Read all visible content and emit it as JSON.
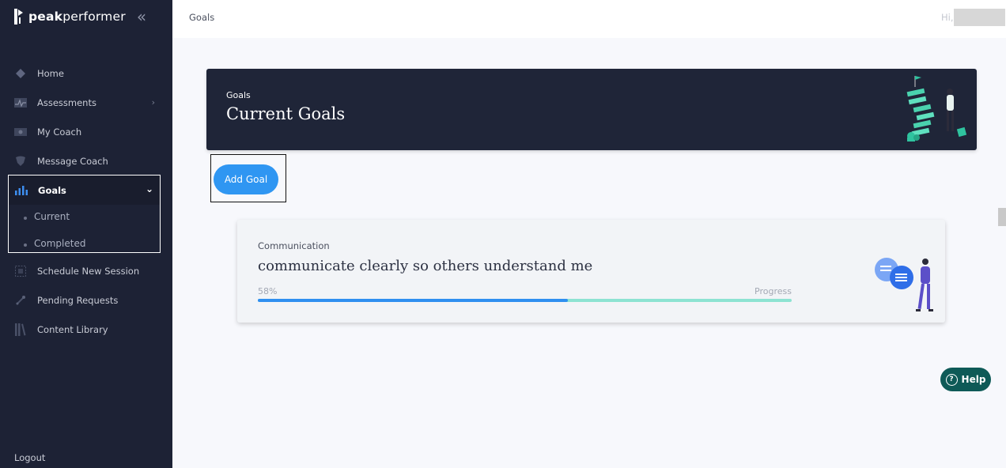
{
  "sidebar": {
    "brand_bold": "peak",
    "brand_rest": "performer",
    "items": [
      {
        "label": "Home",
        "icon": "home-icon"
      },
      {
        "label": "Assessments",
        "icon": "assessments-icon"
      },
      {
        "label": "My Coach",
        "icon": "coach-icon"
      },
      {
        "label": "Message Coach",
        "icon": "message-icon"
      },
      {
        "label": "Goals",
        "icon": "goals-icon"
      },
      {
        "label": "Schedule New Session",
        "icon": "calendar-icon"
      },
      {
        "label": "Pending Requests",
        "icon": "pending-icon"
      },
      {
        "label": "Content Library",
        "icon": "library-icon"
      }
    ],
    "goals_sub": [
      "Current",
      "Completed"
    ],
    "logout": "Logout"
  },
  "topbar": {
    "breadcrumb": "Goals",
    "greeting": "Hi,"
  },
  "banner": {
    "small": "Goals",
    "title": "Current Goals"
  },
  "add_goal_label": "Add Goal",
  "goal_card": {
    "category": "Communication",
    "title": "communicate clearly so others understand me",
    "percent_label": "58%",
    "progress": 0.58,
    "progress_label": "Progress"
  },
  "help_label": "Help",
  "colors": {
    "sidebar": "#1d2235",
    "accent": "#2f96f2",
    "progress_track": "#8de3d2",
    "help": "#0e5a57"
  }
}
